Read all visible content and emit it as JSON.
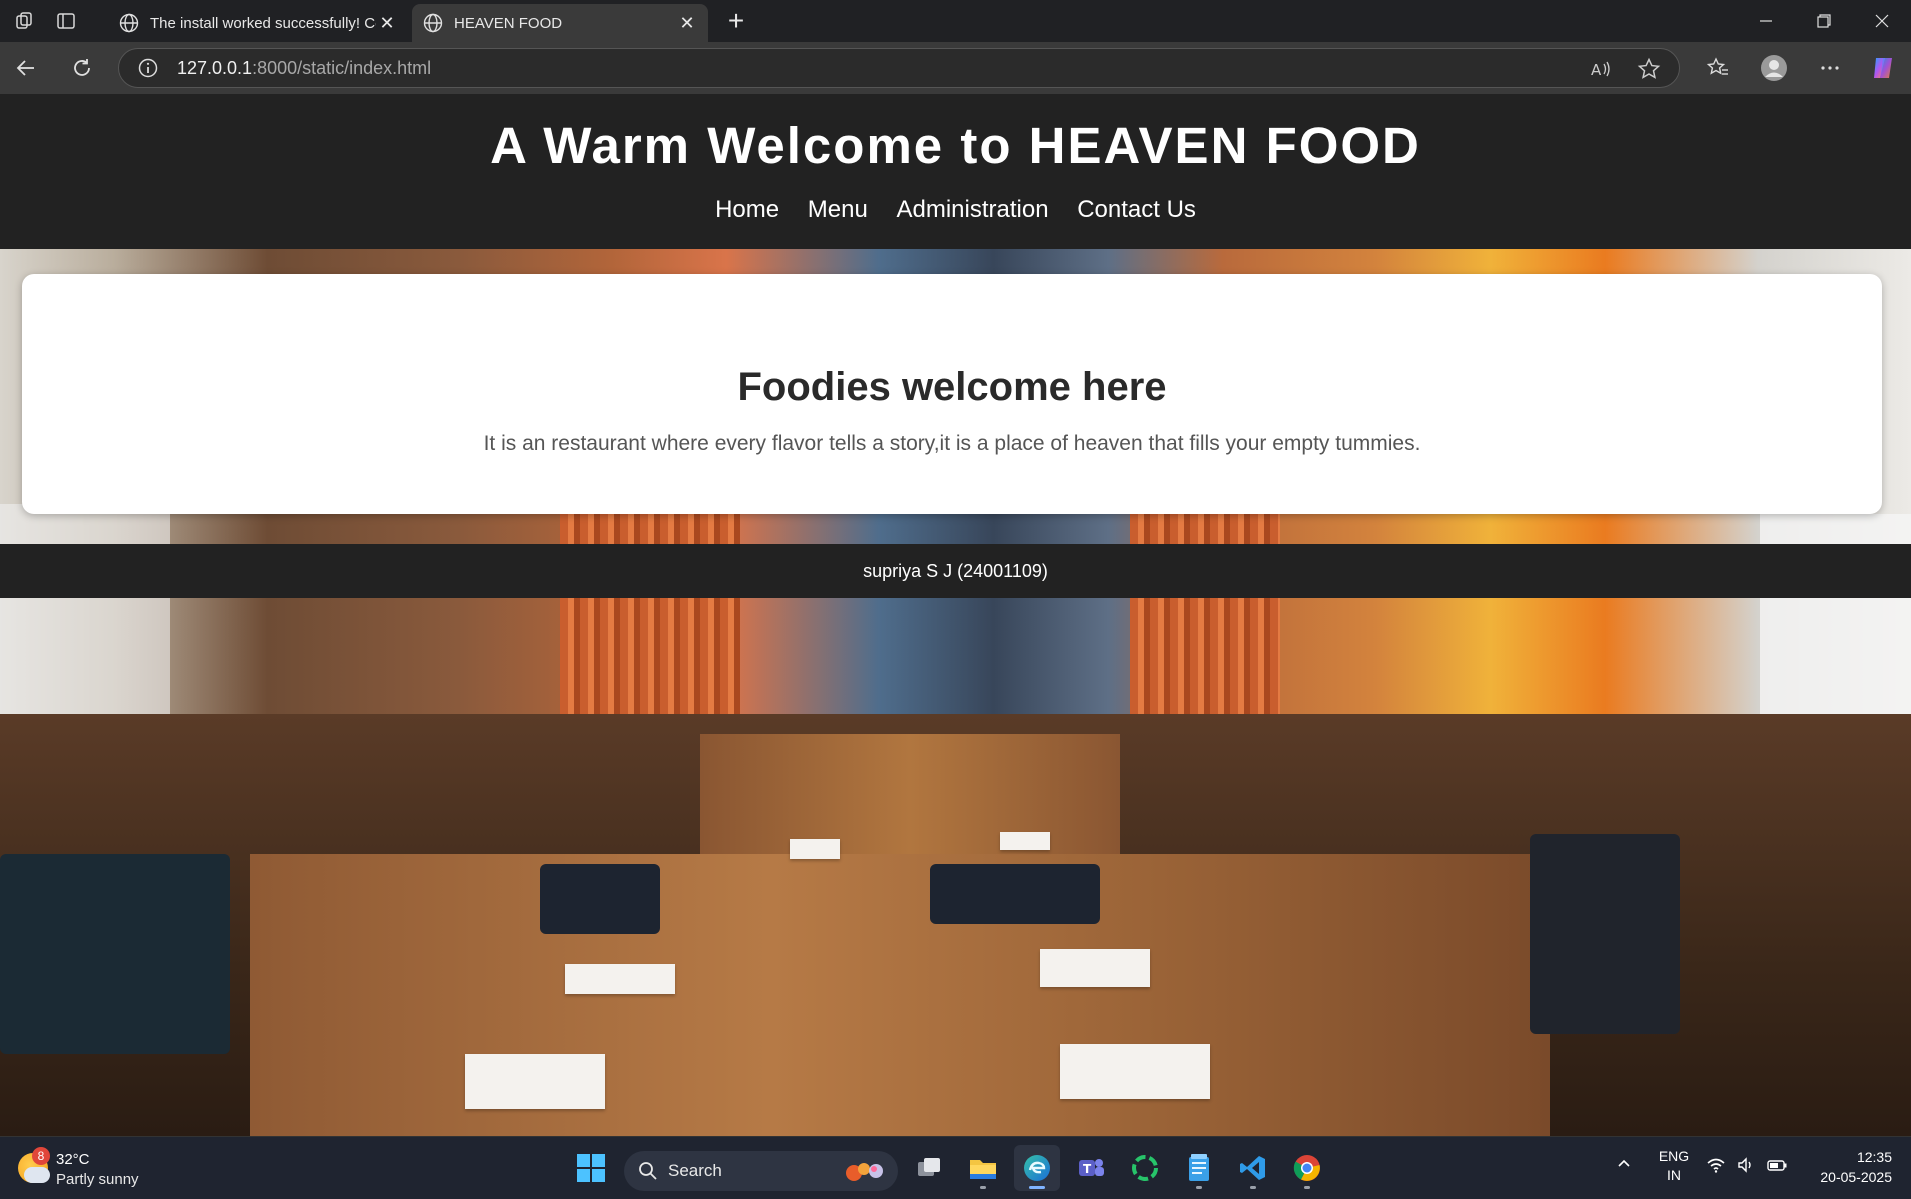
{
  "browser": {
    "tabs": [
      {
        "title": "The install worked successfully! Co",
        "active": false
      },
      {
        "title": "HEAVEN FOOD",
        "active": true
      }
    ],
    "url_host": "127.0.0.1",
    "url_path": ":8000/static/index.html"
  },
  "page": {
    "title": "A Warm Welcome to HEAVEN FOOD",
    "nav": [
      "Home",
      "Menu",
      "Administration",
      "Contact Us"
    ],
    "card_heading": "Foodies welcome here",
    "card_text": "It is an restaurant where every flavor tells a story,it is a place of heaven that fills your empty tummies.",
    "footer": "supriya S J (24001109)"
  },
  "taskbar": {
    "weather_badge": "8",
    "temperature": "32°C",
    "condition": "Partly sunny",
    "search_label": "Search",
    "lang_line1": "ENG",
    "lang_line2": "IN",
    "time": "12:35",
    "date": "20-05-2025"
  },
  "colors": {
    "header_bg": "#222222",
    "card_bg": "#ffffff",
    "taskbar_bg": "#1f2430",
    "browser_frame": "#202124"
  }
}
